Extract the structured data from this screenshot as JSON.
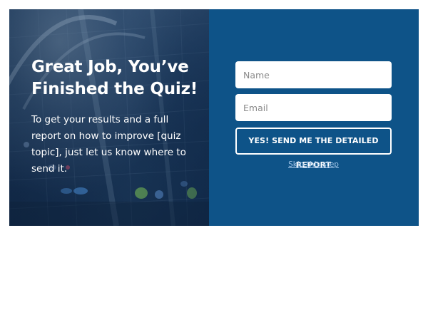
{
  "left_panel": {
    "headline": "Great Job, You’ve\nFinished the Quiz!",
    "subtext": "To get your results and a full report on how to improve [quiz topic], just let us know where to send it."
  },
  "form": {
    "name_placeholder": "Name",
    "name_value": "",
    "email_placeholder": "Email",
    "email_value": "",
    "submit_label": "YES! SEND ME THE DETAILED REPORT",
    "skip_label": "Skip this step"
  },
  "colors": {
    "right_panel_bg": "#0e5388",
    "text": "#ffffff",
    "skip_link": "#9fc3e6"
  }
}
